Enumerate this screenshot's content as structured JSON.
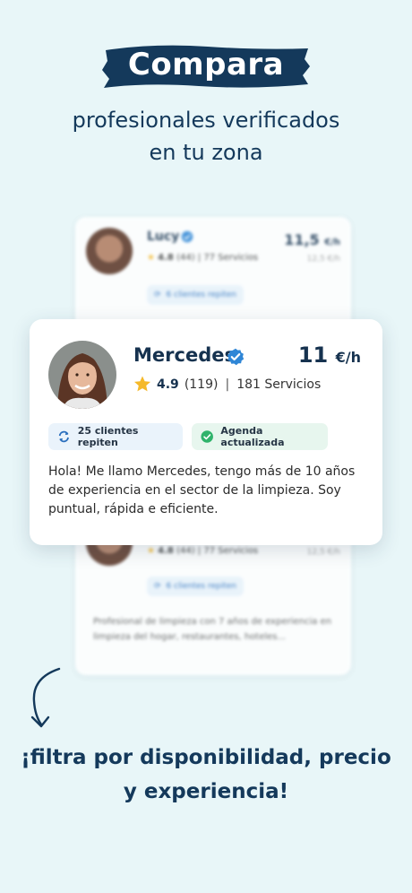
{
  "header": {
    "headline": "Compara",
    "subhead_line1": "profesionales verificados",
    "subhead_line2": "en tu zona"
  },
  "background_card_top": {
    "name": "Lucy",
    "rating": "4.8",
    "reviews": "(44)",
    "services": "77 Servicios",
    "price": "11,5",
    "price_unit": "€/h",
    "extra": "12,5 €/h",
    "chip": "6 clientes repiten"
  },
  "featured_card": {
    "name": "Mercedes",
    "price": "11",
    "price_unit": "€/h",
    "rating": "4.9",
    "reviews": "(119)",
    "separator": "|",
    "services": "181 Servicios",
    "chip_repeat": "25 clientes repiten",
    "chip_agenda": "Agenda actualizada",
    "description": "Hola! Me llamo Mercedes, tengo más de 10 años de experiencia en el sector de la limpieza. Soy puntual, rápida e eficiente."
  },
  "background_card_bottom": {
    "rating": "4.8",
    "reviews": "(44)",
    "services": "77 Servicios",
    "extra": "12,5 €/h",
    "chip": "6 clientes repiten",
    "description": "Profesional de limpieza con 7 años de experiencia en limpieza del hogar, restaurantes, hoteles..."
  },
  "footer": {
    "line1": "¡filtra por disponibilidad, precio",
    "line2": "y experiencia!"
  },
  "colors": {
    "background": "#e8f6f8",
    "navy": "#16324f",
    "verified_blue": "#2f86d6",
    "green": "#2fb36b",
    "star": "#f5b92a"
  },
  "icons": [
    "verified-badge-icon",
    "star-icon",
    "repeat-icon",
    "check-circle-icon",
    "curved-arrow-icon"
  ]
}
